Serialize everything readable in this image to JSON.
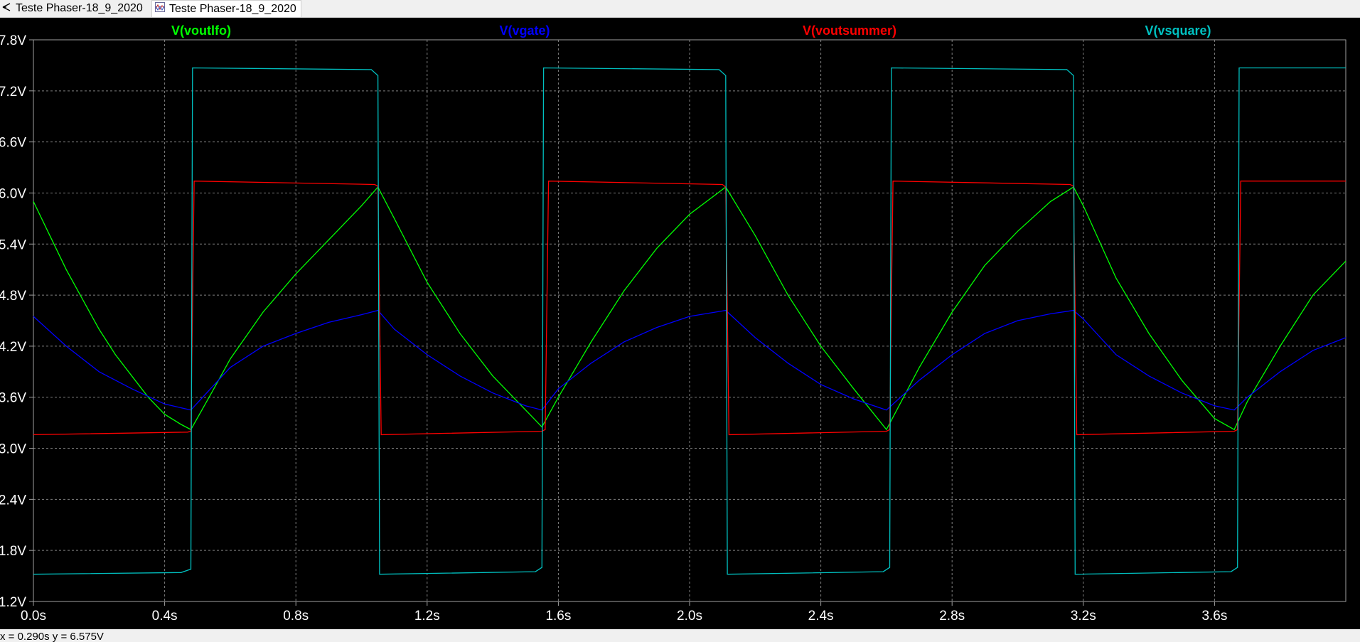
{
  "tabs": [
    {
      "label": "Teste Phaser-18_9_2020",
      "icon": "schematic-icon"
    },
    {
      "label": "Teste Phaser-18_9_2020",
      "icon": "waveform-icon"
    }
  ],
  "status": {
    "text": "x = 0.290s    y = 6.575V"
  },
  "colors": {
    "background": "#000000",
    "grid": "#808080",
    "axis_text": "#ffffff"
  },
  "chart_data": {
    "type": "line",
    "title": "",
    "xlabel": "",
    "ylabel": "",
    "xlim": [
      0,
      4.0
    ],
    "ylim": [
      1.2,
      7.8
    ],
    "grid": true,
    "legend_placement": "top",
    "x_ticks": [
      "0.0s",
      "0.4s",
      "0.8s",
      "1.2s",
      "1.6s",
      "2.0s",
      "2.4s",
      "2.8s",
      "3.2s",
      "3.6s"
    ],
    "x_tick_values": [
      0,
      0.4,
      0.8,
      1.2,
      1.6,
      2.0,
      2.4,
      2.8,
      3.2,
      3.6
    ],
    "y_ticks": [
      "1.2V",
      "1.8V",
      "2.4V",
      "3.0V",
      "3.6V",
      "4.2V",
      "4.8V",
      "5.4V",
      "6.0V",
      "6.6V",
      "7.2V",
      "7.8V"
    ],
    "y_tick_values": [
      1.2,
      1.8,
      2.4,
      3.0,
      3.6,
      4.2,
      4.8,
      5.4,
      6.0,
      6.6,
      7.2,
      7.8
    ],
    "series": [
      {
        "name": "V(voutlfo)",
        "color": "#00ff00",
        "x": [
          0.0,
          0.05,
          0.1,
          0.15,
          0.2,
          0.25,
          0.3,
          0.35,
          0.4,
          0.45,
          0.48,
          0.55,
          0.6,
          0.7,
          0.8,
          0.9,
          1.0,
          1.05,
          1.1,
          1.2,
          1.3,
          1.4,
          1.5,
          1.55,
          1.6,
          1.7,
          1.8,
          1.9,
          2.0,
          2.11,
          2.2,
          2.3,
          2.4,
          2.5,
          2.6,
          2.7,
          2.8,
          2.9,
          3.0,
          3.1,
          3.17,
          3.2,
          3.3,
          3.4,
          3.5,
          3.6,
          3.66,
          3.7,
          3.8,
          3.9,
          4.0
        ],
        "y": [
          5.9,
          5.5,
          5.1,
          4.75,
          4.4,
          4.1,
          3.85,
          3.6,
          3.4,
          3.28,
          3.22,
          3.7,
          4.05,
          4.6,
          5.05,
          5.45,
          5.85,
          6.07,
          5.7,
          4.95,
          4.35,
          3.85,
          3.45,
          3.25,
          3.6,
          4.25,
          4.85,
          5.35,
          5.75,
          6.07,
          5.5,
          4.8,
          4.2,
          3.7,
          3.22,
          3.95,
          4.6,
          5.15,
          5.55,
          5.9,
          6.07,
          5.85,
          5.0,
          4.35,
          3.8,
          3.35,
          3.22,
          3.55,
          4.2,
          4.8,
          5.2
        ]
      },
      {
        "name": "V(vgate)",
        "color": "#0000ff",
        "x": [
          0.0,
          0.1,
          0.2,
          0.3,
          0.4,
          0.48,
          0.6,
          0.7,
          0.8,
          0.9,
          1.0,
          1.05,
          1.1,
          1.2,
          1.3,
          1.4,
          1.5,
          1.55,
          1.6,
          1.7,
          1.8,
          1.9,
          2.0,
          2.11,
          2.2,
          2.3,
          2.4,
          2.5,
          2.6,
          2.7,
          2.8,
          2.9,
          3.0,
          3.1,
          3.17,
          3.2,
          3.3,
          3.4,
          3.5,
          3.6,
          3.66,
          3.7,
          3.8,
          3.9,
          4.0
        ],
        "y": [
          4.55,
          4.2,
          3.9,
          3.7,
          3.52,
          3.45,
          3.95,
          4.2,
          4.35,
          4.48,
          4.57,
          4.62,
          4.4,
          4.1,
          3.85,
          3.65,
          3.5,
          3.45,
          3.7,
          4.0,
          4.25,
          4.42,
          4.55,
          4.62,
          4.3,
          4.0,
          3.75,
          3.58,
          3.45,
          3.8,
          4.1,
          4.35,
          4.5,
          4.58,
          4.62,
          4.52,
          4.1,
          3.85,
          3.65,
          3.5,
          3.45,
          3.6,
          3.9,
          4.15,
          4.3
        ]
      },
      {
        "name": "V(voutsummer)",
        "color": "#ff0000",
        "x": [
          0.0,
          0.47,
          0.48,
          0.49,
          1.04,
          1.05,
          1.06,
          1.55,
          1.56,
          1.57,
          2.1,
          2.11,
          2.12,
          2.6,
          2.61,
          2.62,
          3.16,
          3.17,
          3.18,
          3.66,
          3.67,
          3.68,
          4.0
        ],
        "y": [
          3.16,
          3.19,
          3.2,
          6.14,
          6.1,
          6.08,
          3.16,
          3.2,
          3.22,
          6.14,
          6.1,
          6.07,
          3.16,
          3.2,
          3.22,
          6.14,
          6.1,
          6.08,
          3.16,
          3.2,
          3.22,
          6.14,
          6.14
        ]
      },
      {
        "name": "V(vsquare)",
        "color": "#00c0c0",
        "x": [
          0.0,
          0.45,
          0.48,
          0.485,
          1.03,
          1.05,
          1.055,
          1.53,
          1.55,
          1.555,
          2.09,
          2.11,
          2.115,
          2.59,
          2.61,
          2.615,
          3.15,
          3.17,
          3.175,
          3.65,
          3.67,
          3.675,
          4.0
        ],
        "y": [
          1.52,
          1.54,
          1.58,
          7.47,
          7.45,
          7.38,
          1.52,
          1.55,
          1.6,
          7.47,
          7.45,
          7.38,
          1.52,
          1.55,
          1.6,
          7.47,
          7.45,
          7.38,
          1.52,
          1.55,
          1.6,
          7.47,
          7.47
        ]
      }
    ]
  }
}
